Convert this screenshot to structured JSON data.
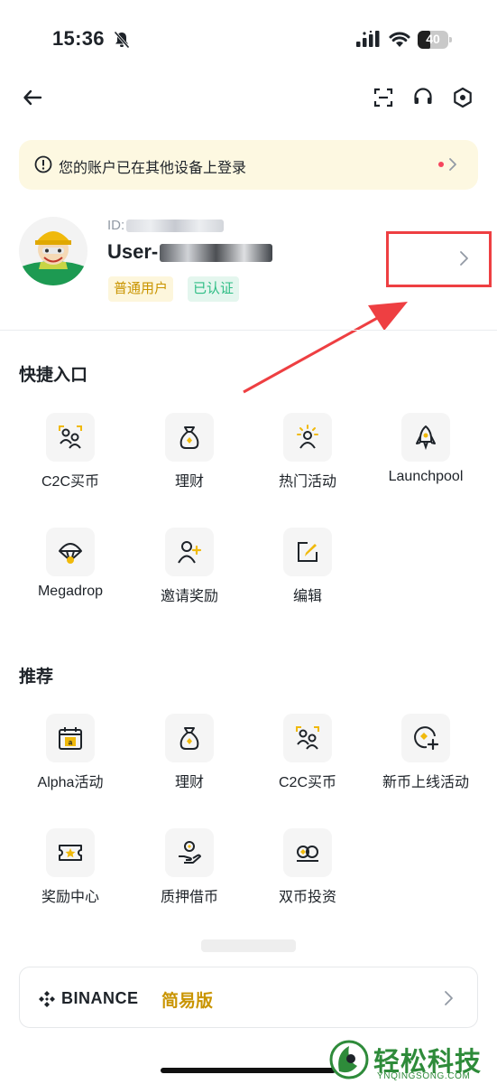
{
  "status_bar": {
    "time": "15:36",
    "battery": "40",
    "battery_level": 0.4
  },
  "notice": {
    "text": "您的账户已在其他设备上登录"
  },
  "profile": {
    "id_prefix": "ID:",
    "username_prefix": "User-",
    "badge_normal": "普通用户",
    "badge_verified": "已认证"
  },
  "quick_access": {
    "title": "快捷入口",
    "items": [
      {
        "label": "C2C买币",
        "icon": "c2c-users-icon"
      },
      {
        "label": "理财",
        "icon": "money-bag-icon"
      },
      {
        "label": "热门活动",
        "icon": "hot-activity-icon"
      },
      {
        "label": "Launchpool",
        "icon": "rocket-icon"
      },
      {
        "label": "Megadrop",
        "icon": "parachute-icon"
      },
      {
        "label": "邀请奖励",
        "icon": "invite-user-icon"
      },
      {
        "label": "编辑",
        "icon": "edit-icon"
      }
    ]
  },
  "recommended": {
    "title": "推荐",
    "items": [
      {
        "label": "Alpha活动",
        "icon": "alpha-calendar-icon"
      },
      {
        "label": "理财",
        "icon": "money-bag-icon"
      },
      {
        "label": "C2C买币",
        "icon": "c2c-users-icon"
      },
      {
        "label": "新币上线活动",
        "icon": "new-listing-icon"
      },
      {
        "label": "奖励中心",
        "icon": "ticket-star-icon"
      },
      {
        "label": "质押借币",
        "icon": "hand-coin-icon"
      },
      {
        "label": "双币投资",
        "icon": "dual-coin-icon"
      }
    ]
  },
  "lite_mode": {
    "brand": "BINANCE",
    "mode": "简易版"
  },
  "watermark": {
    "title": "轻松科技",
    "subtitle": "YNQINGSONG.COM"
  },
  "colors": {
    "accent": "#F0B90B",
    "text": "#1E2329",
    "annotation": "#EE3F42"
  }
}
